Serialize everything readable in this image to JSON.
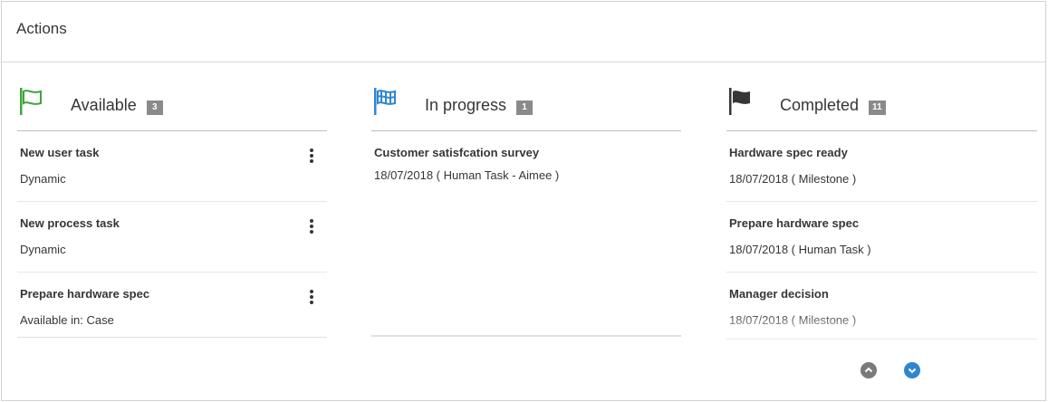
{
  "panel": {
    "title": "Actions"
  },
  "columns": {
    "available": {
      "title": "Available",
      "count": "3",
      "icon": "flag-outline-icon",
      "color": "#3ca63c",
      "items": [
        {
          "title": "New user task",
          "subtitle": "Dynamic"
        },
        {
          "title": "New process task",
          "subtitle": "Dynamic"
        },
        {
          "title": "Prepare hardware spec",
          "subtitle": "Available in: Case"
        }
      ]
    },
    "in_progress": {
      "title": "In progress",
      "count": "1",
      "icon": "flag-checkered-icon",
      "color": "#2f86d0",
      "items": [
        {
          "title": "Customer satisfcation survey",
          "subtitle": "18/07/2018 ( Human Task - Aimee )"
        }
      ]
    },
    "completed": {
      "title": "Completed",
      "count": "11",
      "icon": "flag-filled-icon",
      "color": "#363636",
      "items": [
        {
          "title": "Hardware spec ready",
          "subtitle": "18/07/2018 ( Milestone )"
        },
        {
          "title": "Prepare hardware spec",
          "subtitle": "18/07/2018 ( Human Task )"
        },
        {
          "title": "Manager decision",
          "subtitle": "18/07/2018 ( Milestone )"
        }
      ]
    }
  },
  "pager": {
    "up_icon": "chevron-up-circle-icon",
    "down_icon": "chevron-down-circle-icon"
  }
}
